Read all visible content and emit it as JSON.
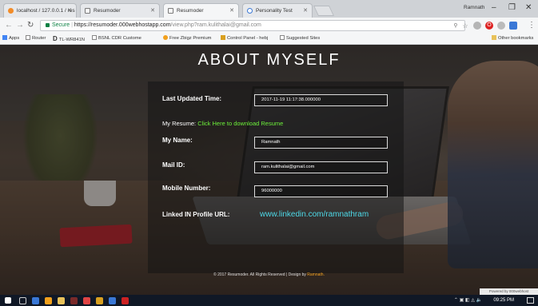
{
  "browser": {
    "tabs": [
      {
        "title": "localhost / 127.0.0.1 / res",
        "icon": "xampp-icon"
      },
      {
        "title": "Resumoder",
        "icon": "page-icon"
      },
      {
        "title": "Resumoder",
        "icon": "page-icon",
        "active": true
      },
      {
        "title": "Personality Test",
        "icon": "loading-icon"
      }
    ],
    "user_name": "Ramnath",
    "window_buttons": {
      "minimize": "–",
      "maximize": "❐",
      "close": "✕"
    },
    "address": {
      "secure_label": "Secure",
      "url_host": "https://resumoder.000webhostapp.com",
      "url_path": "/view.php?ram.kulithalai@gmail.com"
    },
    "bookmarks": [
      {
        "label": "Apps"
      },
      {
        "label": "Router"
      },
      {
        "label": "TL-WR841N"
      },
      {
        "label": "BSNL CDR Custome"
      },
      {
        "label": "Free Zbigz Premium"
      },
      {
        "label": "Control Panel - hebj"
      },
      {
        "label": "Suggested Sites"
      },
      {
        "label": "Other bookmarks"
      }
    ]
  },
  "page": {
    "title": "ABOUT MYSELF",
    "last_updated": {
      "label": "Last Updated Time:",
      "value": "2017-11-19 11:17:38.000000"
    },
    "resume": {
      "prefix": "My Resume:",
      "link_text": "Click Here to download Resume"
    },
    "name": {
      "label": "My Name:",
      "value": "Ramnath"
    },
    "mail": {
      "label": "Mail ID:",
      "value": "ram.kulithalai@gmail.com"
    },
    "mobile": {
      "label": "Mobile Number:",
      "value": "96000000"
    },
    "linkedin": {
      "label": "Linked IN Profile URL:",
      "value": "www.linkedin.com/ramnathram"
    },
    "footer": {
      "text": "© 2017 Resumoder. All Rights Reserved | Design by",
      "author": "Ramnath."
    },
    "badge": "Powered by 000webhost"
  },
  "taskbar": {
    "time": "09:25 PM"
  },
  "colors": {
    "link_green": "#6cf03a",
    "link_cyan": "#4dd9e8",
    "footer_accent": "#f0a020",
    "secure_green": "#0b8043"
  }
}
